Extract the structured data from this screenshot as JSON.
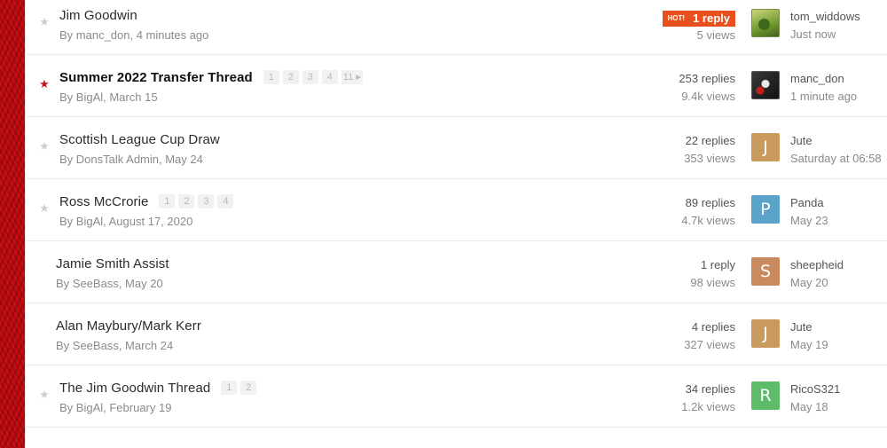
{
  "colors": {
    "accent_red": "#c4161c",
    "hot_orange": "#e8501d",
    "text_dark": "#2b2b2b",
    "text_muted": "#8a8a8a"
  },
  "topics": [
    {
      "title": "Jim Goodwin",
      "bold": false,
      "starred": false,
      "star_icon": "star-icon",
      "pages": [],
      "author_line": "By manc_don, 4 minutes ago",
      "hot": true,
      "hot_label": "HOT!",
      "replies": "1 reply",
      "views": "5 views",
      "avatar": {
        "type": "image",
        "style": "img-green",
        "letter": "",
        "color": ""
      },
      "last_user": "tom_widdows",
      "last_time": "Just now"
    },
    {
      "title": "Summer 2022 Transfer Thread",
      "bold": true,
      "starred": true,
      "star_icon": "star-icon",
      "pages": [
        "1",
        "2",
        "3",
        "4",
        "11 ▸"
      ],
      "author_line": "By BigAl, March 15",
      "hot": false,
      "replies": "253 replies",
      "views": "9.4k views",
      "avatar": {
        "type": "image",
        "style": "img-dark",
        "letter": "",
        "color": ""
      },
      "last_user": "manc_don",
      "last_time": "1 minute ago"
    },
    {
      "title": "Scottish League Cup Draw",
      "bold": false,
      "starred": false,
      "star_icon": "star-icon",
      "pages": [],
      "author_line": "By DonsTalk Admin, May 24",
      "hot": false,
      "replies": "22 replies",
      "views": "353 views",
      "avatar": {
        "type": "letter",
        "style": "",
        "letter": "J",
        "color": "#c99a5e"
      },
      "last_user": "Jute",
      "last_time": "Saturday at 06:58"
    },
    {
      "title": "Ross McCrorie",
      "bold": false,
      "starred": false,
      "star_icon": "star-icon",
      "pages": [
        "1",
        "2",
        "3",
        "4"
      ],
      "author_line": "By BigAl, August 17, 2020",
      "hot": false,
      "replies": "89 replies",
      "views": "4.7k views",
      "avatar": {
        "type": "letter",
        "style": "",
        "letter": "P",
        "color": "#5aa3c9"
      },
      "last_user": "Panda",
      "last_time": "May 23"
    },
    {
      "title": "Jamie Smith Assist",
      "bold": false,
      "starred": null,
      "star_icon": "",
      "pages": [],
      "author_line": "By SeeBass, May 20",
      "hot": false,
      "replies": "1 reply",
      "views": "98 views",
      "avatar": {
        "type": "letter",
        "style": "",
        "letter": "S",
        "color": "#c98a5e"
      },
      "last_user": "sheepheid",
      "last_time": "May 20"
    },
    {
      "title": "Alan Maybury/Mark Kerr",
      "bold": false,
      "starred": null,
      "star_icon": "",
      "pages": [],
      "author_line": "By SeeBass, March 24",
      "hot": false,
      "replies": "4 replies",
      "views": "327 views",
      "avatar": {
        "type": "letter",
        "style": "",
        "letter": "J",
        "color": "#c99a5e"
      },
      "last_user": "Jute",
      "last_time": "May 19"
    },
    {
      "title": "The Jim Goodwin Thread",
      "bold": false,
      "starred": false,
      "star_icon": "star-icon",
      "pages": [
        "1",
        "2"
      ],
      "author_line": "By BigAl, February 19",
      "hot": false,
      "replies": "34 replies",
      "views": "1.2k views",
      "avatar": {
        "type": "letter",
        "style": "",
        "letter": "R",
        "color": "#5dbb6a"
      },
      "last_user": "RicoS321",
      "last_time": "May 18"
    }
  ]
}
